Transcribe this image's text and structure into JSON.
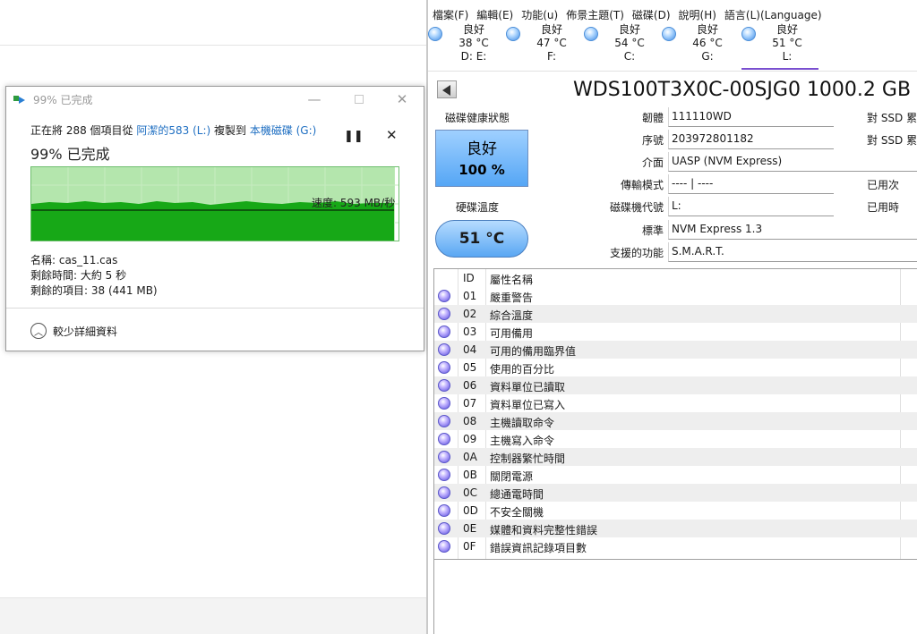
{
  "copy_dialog": {
    "title": "99% 已完成",
    "status_prefix": "正在將 288 個項目從 ",
    "source_link": "阿潔的583 (L:)",
    "status_middle": " 複製到 ",
    "dest_link": "本機磁碟 (G:)",
    "percent_heading": "99% 已完成",
    "speed_label": "速度: 593 MB/秒",
    "transfer_fraction": 0.99,
    "name_line": "名稱: cas_11.cas",
    "time_left_line": "剩餘時間: 大約 5 秒",
    "items_left_line": "剩餘的項目: 38 (441 MB)",
    "details_toggle": "較少詳細資料",
    "controls": {
      "pause": "❚❚",
      "stop": "✕",
      "minimize": "—",
      "close": "✕"
    },
    "colors": {
      "graph_bg": "#b4e6ad",
      "graph_fill": "#17a817",
      "link": "#1f6fc2"
    }
  },
  "cdi": {
    "menu": [
      "檔案(F)",
      "編輯(E)",
      "功能(u)",
      "佈景主題(T)",
      "磁碟(D)",
      "說明(H)",
      "語言(L)(Language)"
    ],
    "disk_tabs": [
      {
        "status": "良好",
        "temp": "38 °C",
        "drive": "D: E:"
      },
      {
        "status": "良好",
        "temp": "47 °C",
        "drive": "F:"
      },
      {
        "status": "良好",
        "temp": "54 °C",
        "drive": "C:"
      },
      {
        "status": "良好",
        "temp": "46 °C",
        "drive": "G:"
      },
      {
        "status": "良好",
        "temp": "51 °C",
        "drive": "L:"
      }
    ],
    "model": "WDS100T3X0C-00SJG0 1000.2 GB",
    "health_label": "磁碟健康狀態",
    "health_status": "良好",
    "health_percent": "100 %",
    "temp_label": "硬碟溫度",
    "temp_value": "51 °C",
    "properties": [
      {
        "key": "韌體",
        "value": "111110WD"
      },
      {
        "key": "序號",
        "value": "203972801182"
      },
      {
        "key": "介面",
        "value": "UASP (NVM Express)"
      },
      {
        "key": "傳輸模式",
        "value": "---- | ----"
      },
      {
        "key": "磁碟機代號",
        "value": "L:"
      },
      {
        "key": "標準",
        "value": "NVM Express 1.3"
      },
      {
        "key": "支援的功能",
        "value": "S.M.A.R.T."
      }
    ],
    "right_labels": [
      "對 SSD 累",
      "對 SSD 累",
      "已用次",
      "已用時"
    ],
    "smart_header": {
      "id": "ID",
      "name": "屬性名稱"
    },
    "smart_rows": [
      {
        "id": "01",
        "name": "嚴重警告"
      },
      {
        "id": "02",
        "name": "綜合溫度"
      },
      {
        "id": "03",
        "name": "可用備用"
      },
      {
        "id": "04",
        "name": "可用的備用臨界值"
      },
      {
        "id": "05",
        "name": "使用的百分比"
      },
      {
        "id": "06",
        "name": "資料單位已讀取"
      },
      {
        "id": "07",
        "name": "資料單位已寫入"
      },
      {
        "id": "08",
        "name": "主機讀取命令"
      },
      {
        "id": "09",
        "name": "主機寫入命令"
      },
      {
        "id": "0A",
        "name": "控制器繁忙時間"
      },
      {
        "id": "0B",
        "name": "關閉電源"
      },
      {
        "id": "0C",
        "name": "總通電時間"
      },
      {
        "id": "0D",
        "name": "不安全關機"
      },
      {
        "id": "0E",
        "name": "媒體和資料完整性錯誤"
      },
      {
        "id": "0F",
        "name": "錯誤資訊記錄項目數"
      }
    ],
    "colors": {
      "health": "#55a6f5",
      "active_tab": "#7a4fd0",
      "row_alt": "#eeeeee"
    }
  }
}
